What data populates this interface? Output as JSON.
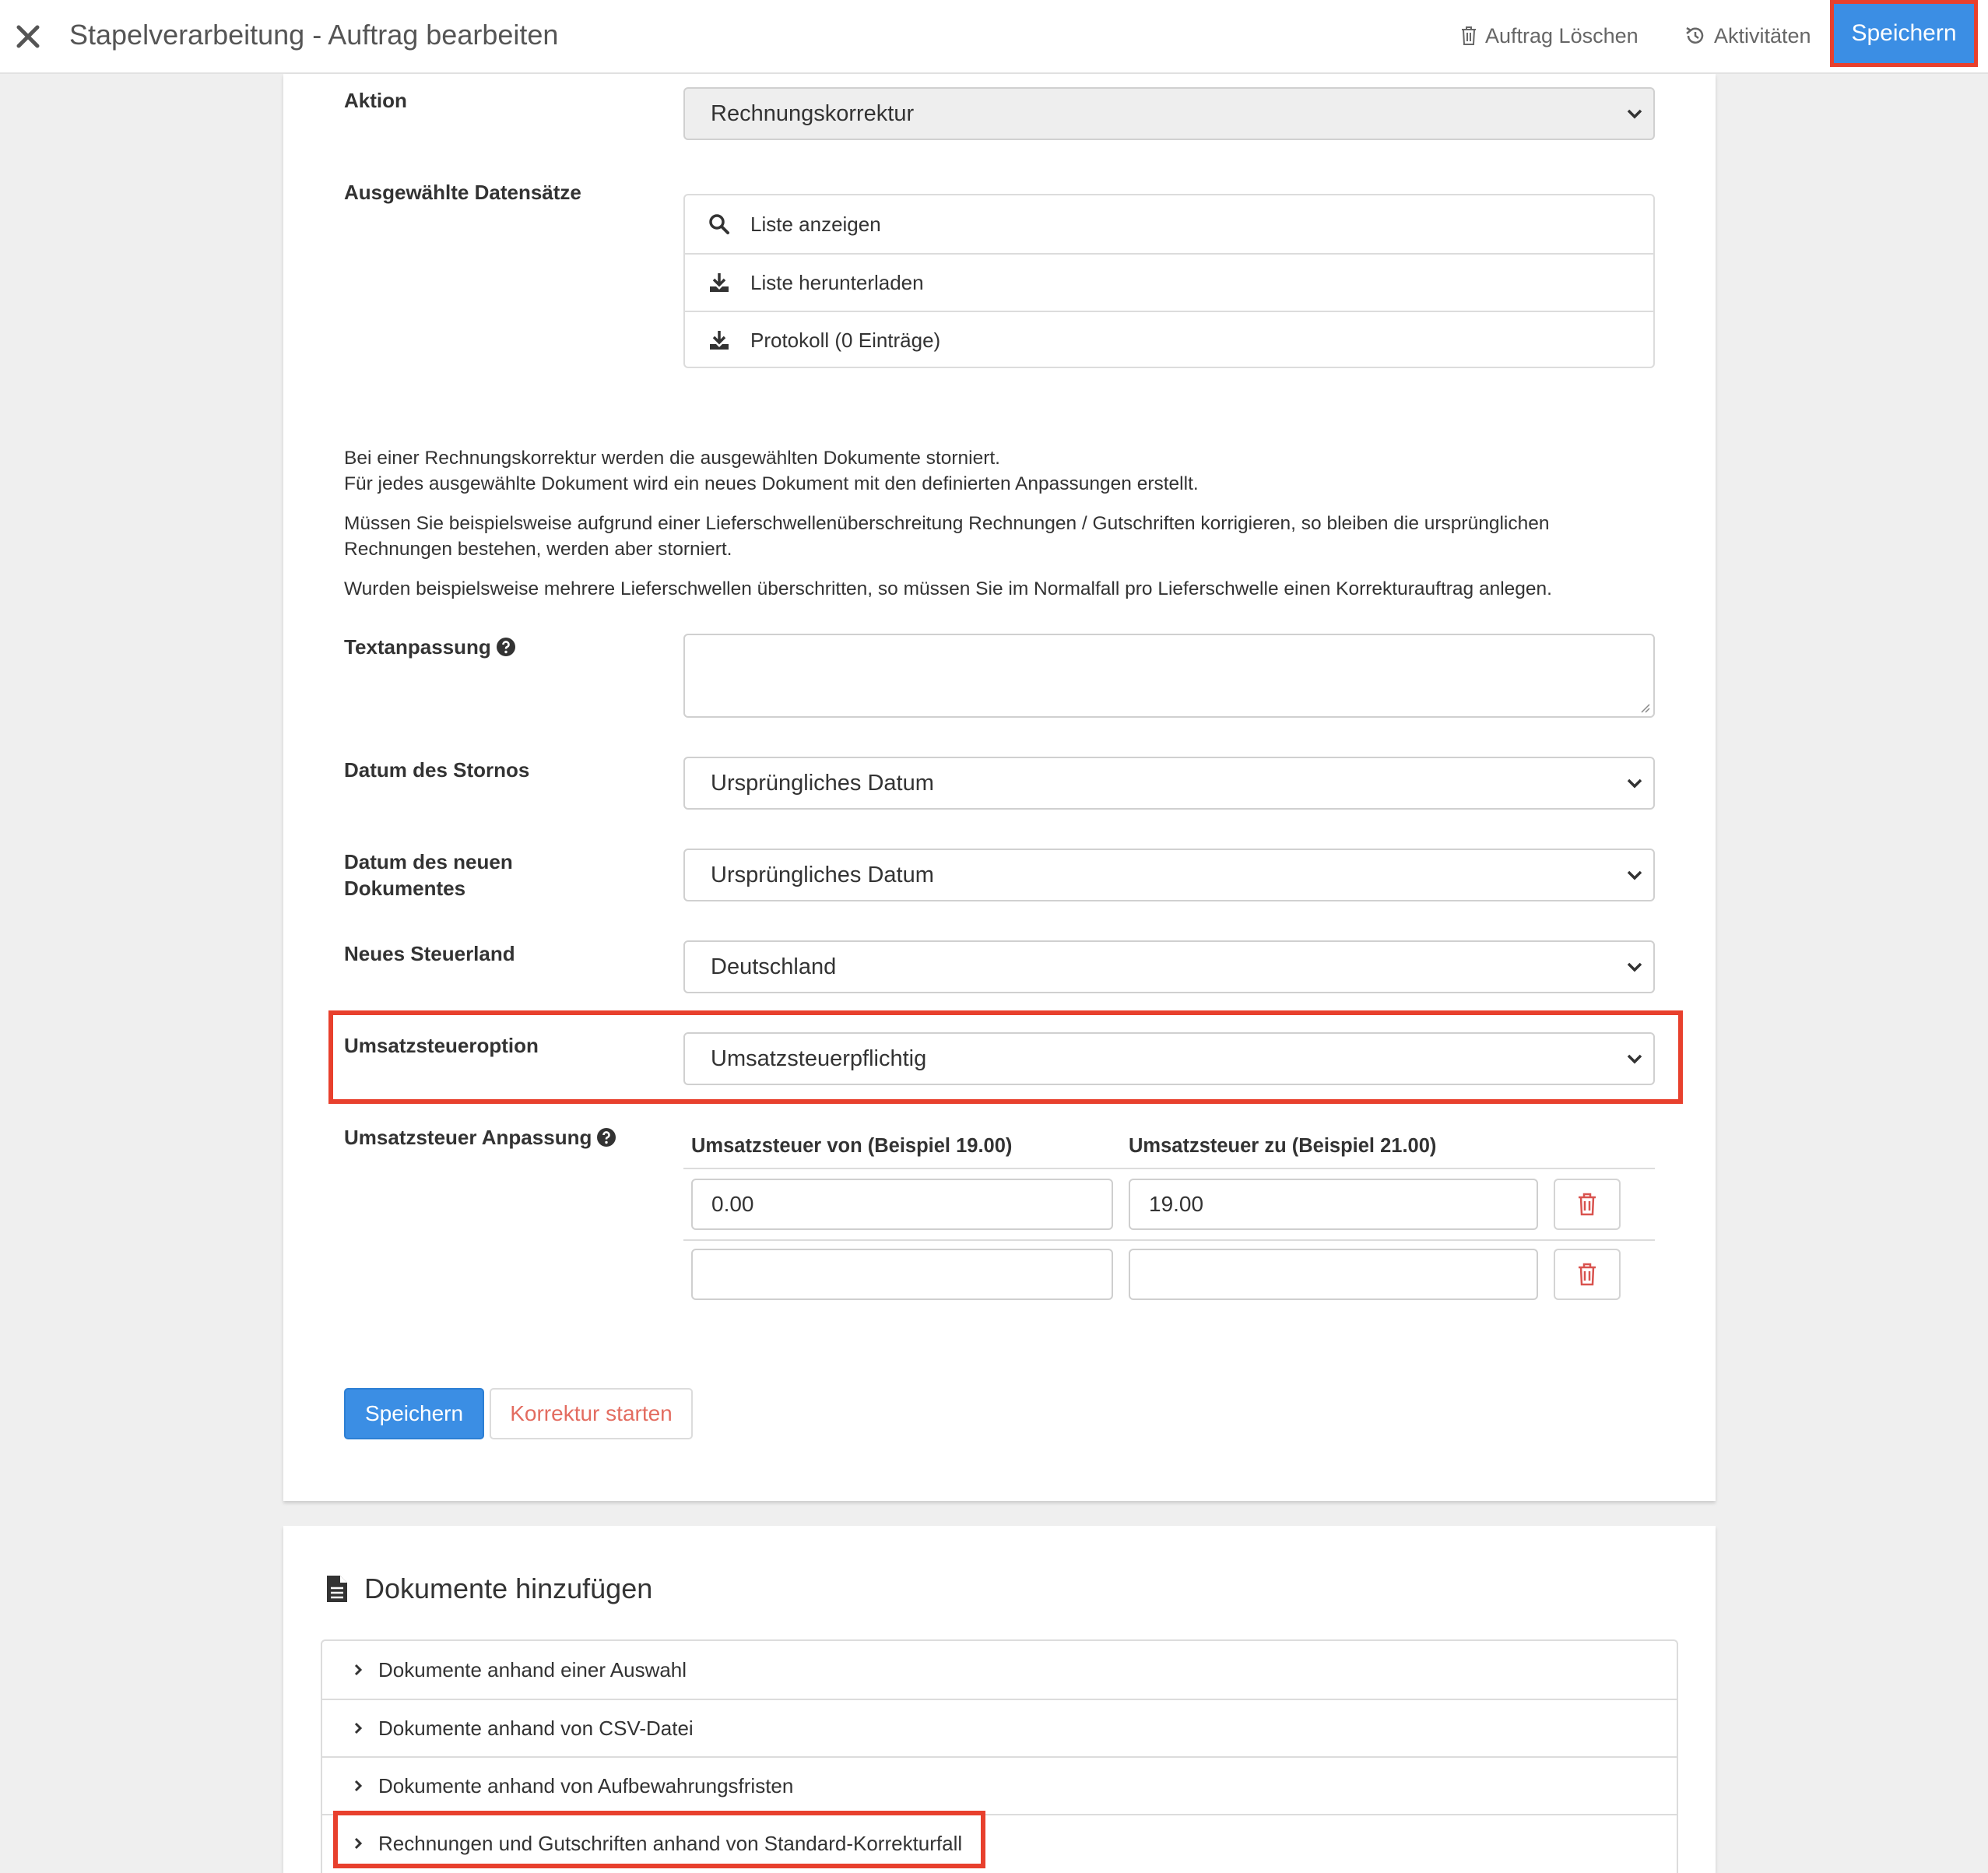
{
  "header": {
    "title": "Stapelverarbeitung - Auftrag bearbeiten",
    "delete_label": "Auftrag Löschen",
    "activities_label": "Aktivitäten",
    "save_label": "Speichern"
  },
  "form": {
    "aktion": {
      "label": "Aktion",
      "value": "Rechnungskorrektur"
    },
    "datensaetze": {
      "label": "Ausgewählte Datensätze",
      "items": [
        {
          "icon": "search-icon",
          "label": "Liste anzeigen"
        },
        {
          "icon": "download-icon",
          "label": "Liste herunterladen"
        },
        {
          "icon": "download-icon",
          "label": "Protokoll (0 Einträge)"
        }
      ]
    },
    "info": [
      "Bei einer Rechnungskorrektur werden die ausgewählten Dokumente storniert.",
      "Für jedes ausgewählte Dokument wird ein neues Dokument mit den definierten Anpassungen erstellt.",
      "Müssen Sie beispielsweise aufgrund einer Lieferschwellenüberschreitung Rechnungen / Gutschriften korrigieren, so bleiben die ursprünglichen",
      "Rechnungen bestehen, werden aber storniert.",
      "Wurden beispielsweise mehrere Lieferschwellen überschritten, so müssen Sie im Normalfall pro Lieferschwelle einen Korrekturauftrag anlegen."
    ],
    "textanpassung": {
      "label": "Textanpassung",
      "value": ""
    },
    "datum_storno": {
      "label": "Datum des Stornos",
      "value": "Ursprüngliches Datum"
    },
    "datum_neu": {
      "label_line1": "Datum des neuen",
      "label_line2": "Dokumentes",
      "value": "Ursprüngliches Datum"
    },
    "steuerland": {
      "label": "Neues Steuerland",
      "value": "Deutschland"
    },
    "ust_option": {
      "label": "Umsatzsteueroption",
      "value": "Umsatzsteuerpflichtig"
    },
    "ust_anpassung": {
      "label": "Umsatzsteuer Anpassung",
      "col_from": "Umsatzsteuer von (Beispiel 19.00)",
      "col_to": "Umsatzsteuer zu (Beispiel 21.00)",
      "rows": [
        {
          "from": "0.00",
          "to": "19.00"
        },
        {
          "from": "",
          "to": ""
        }
      ]
    },
    "save_label": "Speichern",
    "start_label": "Korrektur starten"
  },
  "documents": {
    "title": "Dokumente hinzufügen",
    "items": [
      "Dokumente anhand einer Auswahl",
      "Dokumente anhand von CSV-Datei",
      "Dokumente anhand von Aufbewahrungsfristen",
      "Rechnungen und Gutschriften anhand von Standard-Korrekturfall"
    ]
  },
  "colors": {
    "primary": "#3b8ee4",
    "highlight": "#e8402d",
    "danger": "#d9534f"
  }
}
